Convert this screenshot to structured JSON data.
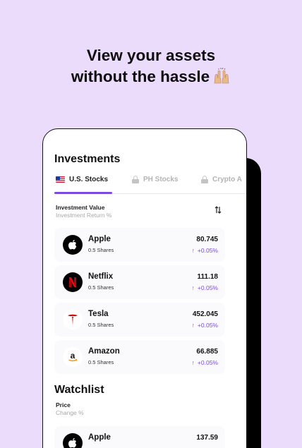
{
  "headline": {
    "line1": "View your assets",
    "line2": "without the hassle"
  },
  "investments": {
    "title": "Investments",
    "tabs": [
      {
        "label": "U.S. Stocks",
        "icon": "us-flag-icon",
        "active": true
      },
      {
        "label": "PH Stocks",
        "icon": "lock-icon",
        "active": false
      },
      {
        "label": "Crypto A",
        "icon": "lock-icon",
        "active": false
      }
    ],
    "column_primary": "Investment Value",
    "column_secondary": "Investment Return %",
    "sort_icon": "sort-arrows-icon",
    "rows": [
      {
        "name": "Apple",
        "shares": "0.5 Shares",
        "value": "80.745",
        "change": "+0.05%",
        "logo": "apple-logo-icon"
      },
      {
        "name": "Netflix",
        "shares": "0.5 Shares",
        "value": "111.18",
        "change": "+0.05%",
        "logo": "netflix-logo-icon"
      },
      {
        "name": "Tesla",
        "shares": "0.5 Shares",
        "value": "452.045",
        "change": "+0.05%",
        "logo": "tesla-logo-icon"
      },
      {
        "name": "Amazon",
        "shares": "0.5 Shares",
        "value": "66.885",
        "change": "+0.05%",
        "logo": "amazon-logo-icon"
      }
    ]
  },
  "watchlist": {
    "title": "Watchlist",
    "column_primary": "Price",
    "column_secondary": "Change %",
    "rows": [
      {
        "name": "Apple",
        "value": "137.59",
        "logo": "apple-logo-icon"
      }
    ]
  },
  "colors": {
    "background": "#ecdcfb",
    "accent": "#7a4be0",
    "text": "#111111",
    "muted": "#a8a8a8",
    "netflix_red": "#e50914",
    "tesla_red": "#cc0000"
  }
}
